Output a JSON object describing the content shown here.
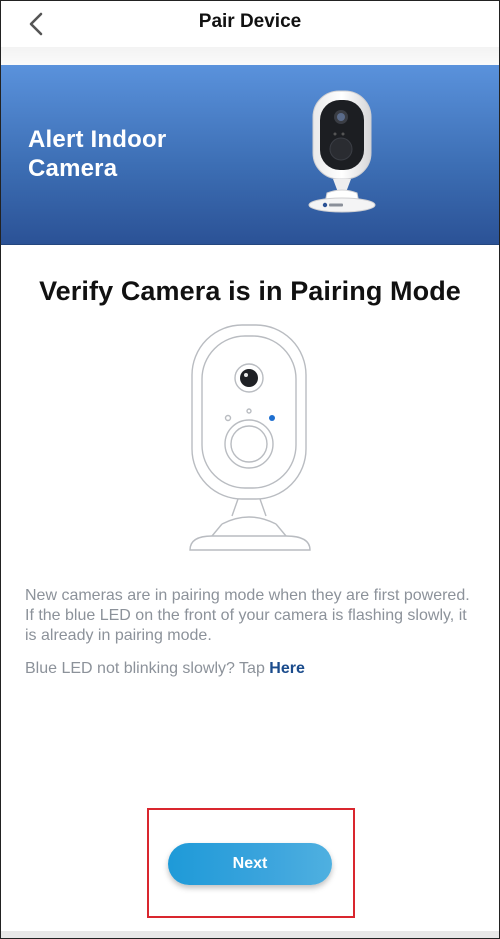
{
  "header": {
    "title": "Pair Device",
    "back_icon": "chevron-left-icon"
  },
  "banner": {
    "title": "Alert Indoor Camera",
    "gradient_top": "#5a92dc",
    "gradient_bottom": "#2b5296"
  },
  "main": {
    "title": "Verify Camera is in Pairing Mode",
    "description": "New cameras are in pairing mode when they are first powered. If the blue LED on the front of your camera is flashing slowly, it is already in pairing mode.",
    "help_text": "Blue LED not blinking slowly? Tap ",
    "help_link": "Here"
  },
  "footer": {
    "next_label": "Next"
  },
  "colors": {
    "accent": "#1e9ad8",
    "highlight": "#d9262e",
    "link": "#1a4b8c",
    "led": "#1e6fd0"
  }
}
